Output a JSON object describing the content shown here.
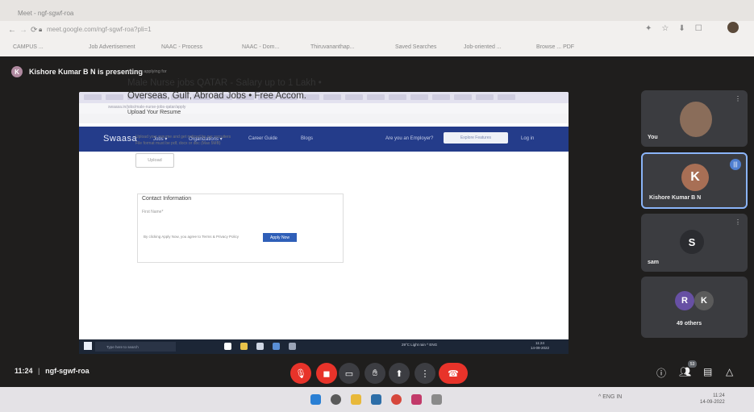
{
  "outer_browser": {
    "tabs": [
      "Meet - ngf-sgwf-roa"
    ],
    "url": "meet.google.com/ngf-sgwf-roa?pli=1",
    "bookmarks": [
      "CAMPUS ...",
      "Job Advertisement",
      "NAAC - Process",
      "NAAC - Dom...",
      "Thiruvananthap...",
      "Saved Searches",
      "Job-oriented ...",
      "Browse ... PDF"
    ]
  },
  "meet": {
    "presenter_initial": "K",
    "presenting_label": "Kishore Kumar B N is presenting",
    "meeting_time": "11:24",
    "meeting_code": "ngf-sgwf-roa",
    "people_badge": "53",
    "colors": {
      "background": "#1f1e1d",
      "end_call": "#e8332a",
      "tile": "#3b3c40"
    }
  },
  "shared_screen": {
    "inner_url": "swaasa.in/jobs/male-nurse-jobs-qatar/apply",
    "site": {
      "logo": "Swaasa",
      "nav": [
        "Jobs ▾",
        "Organizations ▾",
        "Career Guide",
        "Blogs"
      ],
      "nav_right_link": "Are you an Employer?",
      "nav_right_button": "Explore Features",
      "nav_extra": "Log in"
    },
    "applying_label": "You are applying for",
    "job_title": "Male Nurse jobs QATAR - Salary up to 1 Lakh • Overseas, Gulf, Abroad Jobs • Free Accom.",
    "upload_heading": "Upload Your Resume",
    "upload_text_1": "Upload your resume and get noticed by our recruiters",
    "upload_text_2": "File format must be pdf, docx or doc (Max 5MB)",
    "upload_button": "Upload",
    "contact_title": "Contact Information",
    "first_name_label": "First Name*",
    "apply_row_text": "By clicking Apply Now, you agree to Terms & Privacy Policy",
    "apply_button": "Apply Now",
    "taskbar_search": "Type here to search",
    "tray_text": "29°C  Light rain  ^  ENG",
    "inner_clock_time": "11:24",
    "inner_clock_date": "14-09-2022"
  },
  "participants": [
    {
      "name": "You",
      "initial": "",
      "type": "video"
    },
    {
      "name": "Kishore Kumar B N",
      "initial": "K",
      "avatar_color": "#a86f55",
      "speaking": true
    },
    {
      "name": "sam",
      "initial": "S",
      "avatar_color": "#3c4043"
    },
    {
      "name": "49 others",
      "initials": [
        "R",
        "K"
      ],
      "avatar_colors": [
        "#6750a4",
        "#5b5b5b"
      ]
    }
  ],
  "controls": [
    "mic-off",
    "camera-off",
    "captions",
    "raise-hand",
    "present",
    "more",
    "end-call"
  ],
  "right_controls": [
    "info",
    "people",
    "chat",
    "activities"
  ],
  "windows": {
    "tray": "^  ENG IN",
    "clock_time": "11:24",
    "clock_date": "14-09-2022"
  }
}
